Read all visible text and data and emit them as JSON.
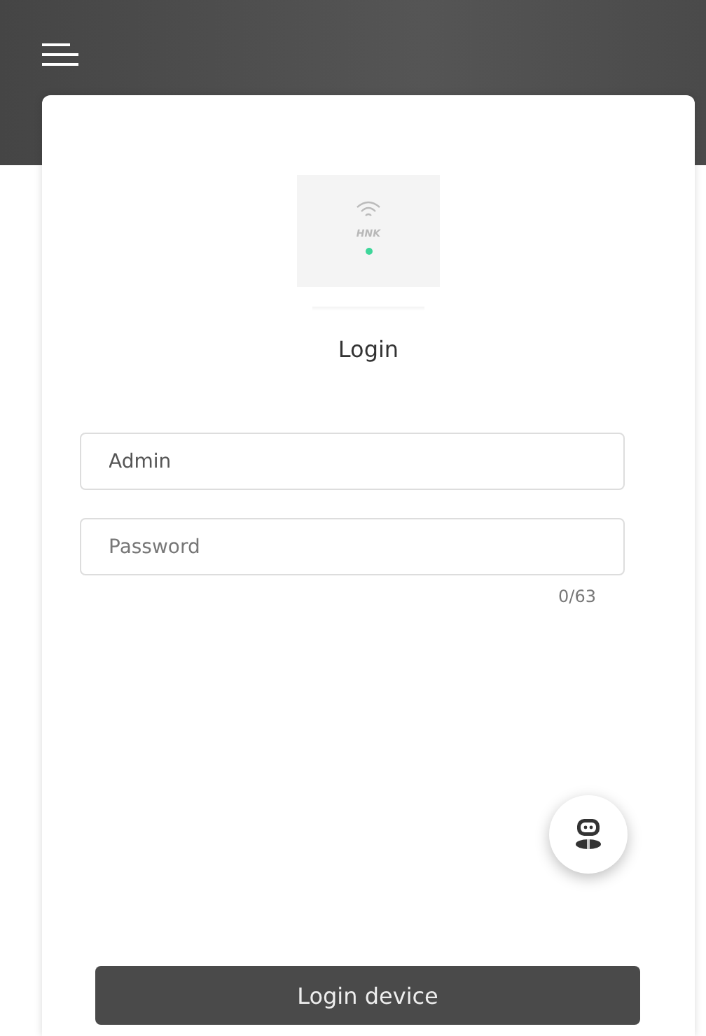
{
  "device": {
    "label": "HNK",
    "online": true
  },
  "title": "Login",
  "fields": [
    {
      "kind": "text",
      "value": "Admin"
    },
    {
      "kind": "password",
      "placeholder": "Password",
      "counter": "0/63"
    }
  ],
  "submit": {
    "label": "Login device"
  }
}
